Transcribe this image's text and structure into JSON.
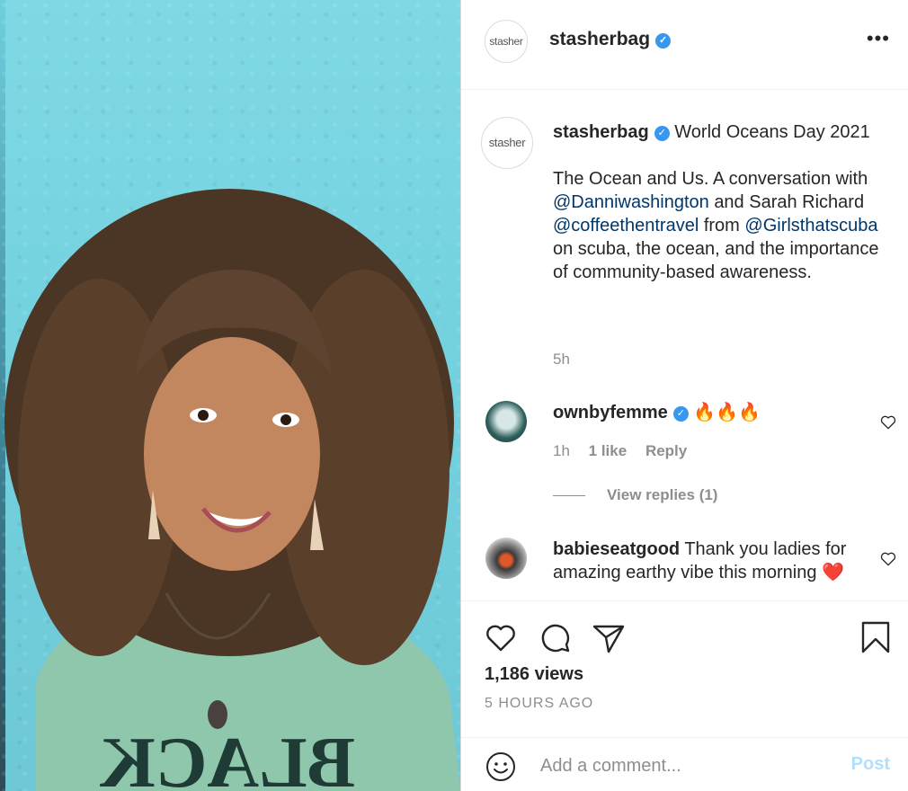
{
  "post": {
    "username": "stasherbag",
    "avatar_text": "stasher",
    "more_icon": "more-horizontal-icon",
    "caption_title": "World Oceans Day 2021",
    "caption_intro": "The Ocean and Us. A conversation with",
    "mention_1": "@Danniwashington",
    "caption_mid": "and Sarah Richard",
    "mention_2": "@coffeethentravel",
    "caption_from": "from",
    "mention_3": "@Girlsthatscuba",
    "caption_end": "on scuba, the ocean, and the importance of community-based awareness.",
    "age": "5h"
  },
  "comments": [
    {
      "username": "ownbyfemme",
      "text": "🔥🔥🔥",
      "age": "1h",
      "likes": "1 like",
      "reply": "Reply",
      "view_replies": "View replies (1)"
    },
    {
      "username": "babieseatgood",
      "text": "Thank you ladies for amazing earthy vibe this morning ❤️"
    }
  ],
  "actions": {
    "views": "1,186 views",
    "timestamp": "5 HOURS AGO"
  },
  "comment_box": {
    "placeholder": "Add a comment...",
    "post_label": "Post"
  },
  "colors": {
    "link": "#00376b",
    "verified": "#3897f0",
    "muted": "#8e8e8e",
    "post_disabled": "#b2dffc"
  }
}
